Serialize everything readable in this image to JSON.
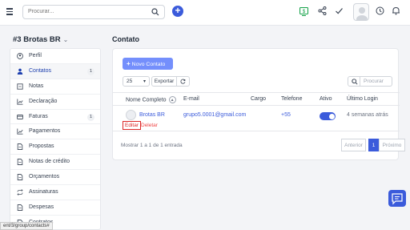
{
  "topbar": {
    "search_placeholder": "Procurar..."
  },
  "sidebar": {
    "account_name": "#3 Brotas BR",
    "items": [
      {
        "label": "Perfil",
        "icon": "user-circle-icon",
        "badge": ""
      },
      {
        "label": "Contatos",
        "icon": "user-icon",
        "badge": "1"
      },
      {
        "label": "Notas",
        "icon": "note-icon",
        "badge": ""
      },
      {
        "label": "Declaração",
        "icon": "chart-icon",
        "badge": ""
      },
      {
        "label": "Faturas",
        "icon": "card-icon",
        "badge": "1"
      },
      {
        "label": "Pagamentos",
        "icon": "chart-line-icon",
        "badge": ""
      },
      {
        "label": "Propostas",
        "icon": "document-icon",
        "badge": ""
      },
      {
        "label": "Notas de crédito",
        "icon": "document-icon",
        "badge": ""
      },
      {
        "label": "Orçamentos",
        "icon": "document-icon",
        "badge": ""
      },
      {
        "label": "Assinaturas",
        "icon": "repeat-icon",
        "badge": ""
      },
      {
        "label": "Despesas",
        "icon": "document-icon",
        "badge": ""
      },
      {
        "label": "Contratos",
        "icon": "document-icon",
        "badge": ""
      }
    ]
  },
  "main": {
    "title": "Contato",
    "new_contact_label": "Novo Contato",
    "page_size": "25",
    "export_label": "Exportar",
    "search_placeholder": "Procurar",
    "columns": [
      "Nome Completo",
      "E-mail",
      "Cargo",
      "Telefone",
      "Ativo",
      "Último Login"
    ],
    "row": {
      "name": "Brotas BR",
      "edit": "Editar",
      "delete": "Deletar",
      "email": "grupo5.0001@gmail.com",
      "position": "",
      "phone": "+55",
      "active": true,
      "last_login": "4 semanas atrás"
    },
    "showing": "Mostrar 1 a 1 de 1 entrada",
    "pagination": {
      "previous": "Anterior",
      "current": "1",
      "next": "Próximo"
    }
  },
  "status_bar": {
    "url": "ent/3/group/contacts#"
  },
  "colors": {
    "primary": "#3b5bdb",
    "button_light": "#748ffc",
    "danger": "#dc2626"
  }
}
